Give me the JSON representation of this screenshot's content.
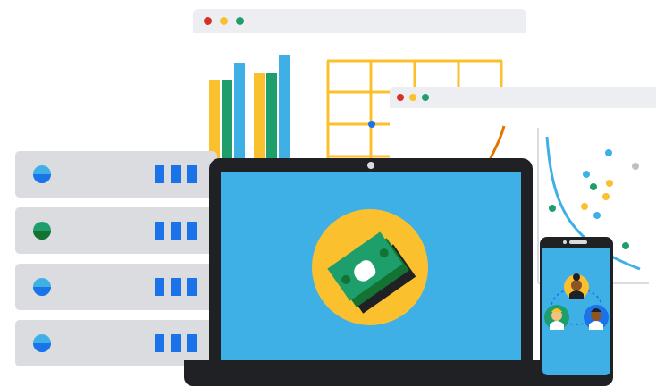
{
  "colors": {
    "blue": "#1a73e8",
    "sky": "#3fb0e6",
    "green": "#1e9e6a",
    "yellow": "#fbc02d",
    "orange": "#e37400",
    "red": "#d93025",
    "dark": "#202124",
    "grey": "#dadce0",
    "window_bar": "#eceef1"
  },
  "window_controls": [
    "red-dot",
    "yellow-dot",
    "green-dot"
  ],
  "server_rack": {
    "units": [
      {
        "led": "blue-led"
      },
      {
        "led": "green-led"
      },
      {
        "led": "blue-led"
      },
      {
        "led": "blue-led"
      }
    ]
  },
  "laptop": {
    "screen_icon": "money-bills-icon"
  },
  "phone": {
    "screen_icon": "people-network-icon"
  },
  "charts": {
    "bar_chart": {
      "icon": "bar-chart-icon"
    },
    "grid_table": {
      "icon": "grid-table-icon"
    },
    "scatter_plot": {
      "icon": "scatter-plot-icon"
    }
  }
}
